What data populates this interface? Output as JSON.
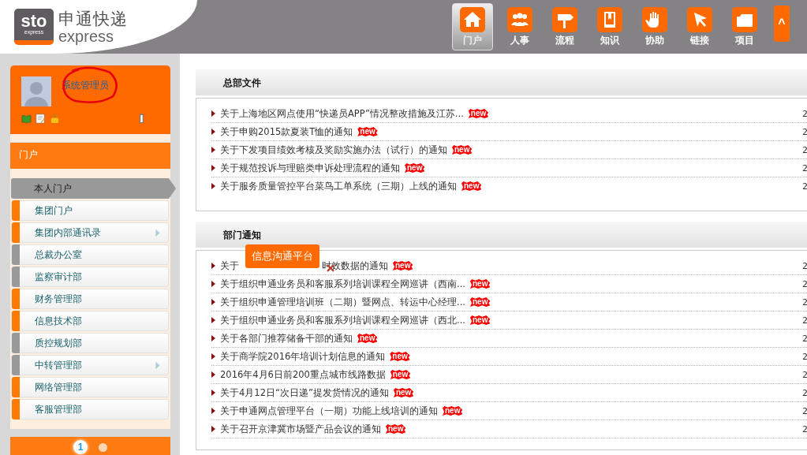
{
  "logo": {
    "mark": "sto",
    "mark_sub": "express",
    "name_cn": "申通快递",
    "name_en": "express"
  },
  "nav": [
    {
      "label": "门户",
      "selected": true
    },
    {
      "label": "人事",
      "selected": false
    },
    {
      "label": "流程",
      "selected": false
    },
    {
      "label": "知识",
      "selected": false
    },
    {
      "label": "协助",
      "selected": false
    },
    {
      "label": "链接",
      "selected": false
    },
    {
      "label": "项目",
      "selected": false
    }
  ],
  "nav_toggle": "^",
  "user": {
    "name": "系统管理员",
    "annotated": true
  },
  "sidebar": {
    "section": "门户",
    "items": [
      {
        "label": "本人门户",
        "selected": true,
        "submenu": false
      },
      {
        "label": "集团门户",
        "selected": false,
        "color": "#ff7a00",
        "submenu": false
      },
      {
        "label": "集团内部通讯录",
        "selected": false,
        "color": "#ff7a00",
        "submenu": true
      },
      {
        "label": "总裁办公室",
        "selected": false,
        "color": "#999999",
        "submenu": false
      },
      {
        "label": "监察审计部",
        "selected": false,
        "color": "#999999",
        "submenu": false
      },
      {
        "label": "财务管理部",
        "selected": false,
        "color": "#ff7a00",
        "submenu": false
      },
      {
        "label": "信息技术部",
        "selected": false,
        "color": "#ff7a00",
        "submenu": false
      },
      {
        "label": "质控规划部",
        "selected": false,
        "color": "#999999",
        "submenu": false
      },
      {
        "label": "中转管理部",
        "selected": false,
        "color": "#999999",
        "submenu": true
      },
      {
        "label": "网络管理部",
        "selected": false,
        "color": "#ff7a00",
        "submenu": false
      },
      {
        "label": "客服管理部",
        "selected": false,
        "color": "#ff7a00",
        "submenu": false
      }
    ],
    "pages": [
      {
        "label": "1",
        "selected": true
      },
      {
        "selected": false
      }
    ]
  },
  "sections": [
    {
      "title": "总部文件",
      "rows": [
        {
          "parts": [
            "关于上海地区网点使用“快递员APP”情况整改措施及江苏..."
          ],
          "badge": "new",
          "date": "2"
        },
        {
          "parts": [
            "关于申购2015款夏装T恤的通知"
          ],
          "badge": "new",
          "date": "2"
        },
        {
          "parts": [
            "关于下发项目绩效考核及奖励实施办法（试行）的通知"
          ],
          "badge": "new",
          "date": "2"
        },
        {
          "parts": [
            "关于规范投诉与理赔类申诉处理流程的通知"
          ],
          "badge": "new",
          "date": "2"
        },
        {
          "parts": [
            "关于服务质量管控平台菜鸟工单系统（三期）上线的通知"
          ],
          "badge": "new",
          "date": "2"
        }
      ]
    },
    {
      "title": "部门通知",
      "rows": [
        {
          "parts": [
            "关于",
            "时效数据的通知"
          ],
          "badge": "new",
          "date": "2"
        },
        {
          "parts": [
            "关于组织申通业务员和客服系列培训课程全网巡讲（西南..."
          ],
          "badge": "new",
          "date": "2"
        },
        {
          "parts": [
            "关于组织申通管理培训班（二期）暨网点、转运中心经理..."
          ],
          "badge": "new",
          "date": "2"
        },
        {
          "parts": [
            "关于组织申通业务员和客服系列培训课程全网巡讲（西北..."
          ],
          "badge": "new",
          "date": "2"
        },
        {
          "parts": [
            "关于各部门推荐储备干部的通知"
          ],
          "badge": "new",
          "date": "2"
        },
        {
          "parts": [
            "关于商学院2016年培训计划信息的通知"
          ],
          "badge": "new",
          "date": "2"
        },
        {
          "parts": [
            "2016年4月6日前200重点城市线路数据"
          ],
          "badge": "new",
          "date": "2"
        },
        {
          "parts": [
            "关于4月12日“次日递”提发货情况的通知"
          ],
          "badge": "new",
          "date": "2"
        },
        {
          "parts": [
            "关于申通网点管理平台（一期）功能上线培训的通知"
          ],
          "badge": "new",
          "date": "2"
        },
        {
          "parts": [
            "关于召开京津冀市场暨产品会议的通知"
          ],
          "badge": "new",
          "date": "2"
        }
      ]
    }
  ],
  "tooltip": {
    "text": "信息沟通平台"
  }
}
